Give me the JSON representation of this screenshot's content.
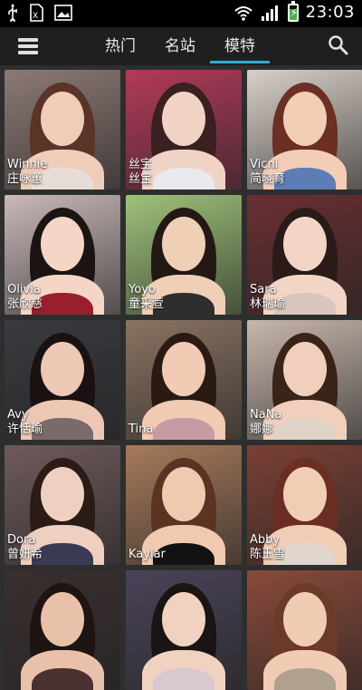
{
  "status_bar": {
    "time": "23:03",
    "icons": [
      "usb-icon",
      "sim-icon",
      "image-icon",
      "wifi-icon",
      "signal-icon",
      "battery-charging-icon"
    ],
    "battery_level_percent": 70
  },
  "toolbar": {
    "menu_icon": "menu-icon",
    "tabs": [
      {
        "label": "热门",
        "active": false
      },
      {
        "label": "名站",
        "active": false
      },
      {
        "label": "模特",
        "active": true
      }
    ],
    "search_icon": "search-icon",
    "accent_color": "#35a7d3"
  },
  "models": [
    {
      "line1": "Winnie",
      "line2": "庄咏蕙"
    },
    {
      "line1": "丝宝",
      "line2": "丝宝"
    },
    {
      "line1": "Vicni",
      "line2": "简晓育"
    },
    {
      "line1": "Olivia",
      "line2": "张欣慈"
    },
    {
      "line1": "Yoyo",
      "line2": "童采萱"
    },
    {
      "line1": "Sara",
      "line2": "林瑞瑜"
    },
    {
      "line1": "Avy",
      "line2": "许恬瑜"
    },
    {
      "line1": "Tina",
      "line2": ""
    },
    {
      "line1": "NaNa",
      "line2": "娜娜"
    },
    {
      "line1": "Dora",
      "line2": "曾妍希"
    },
    {
      "line1": "Kaylar",
      "line2": ""
    },
    {
      "line1": "Abby",
      "line2": "陈玉雪"
    },
    {
      "line1": "",
      "line2": ""
    },
    {
      "line1": "",
      "line2": ""
    },
    {
      "line1": "",
      "line2": ""
    }
  ]
}
